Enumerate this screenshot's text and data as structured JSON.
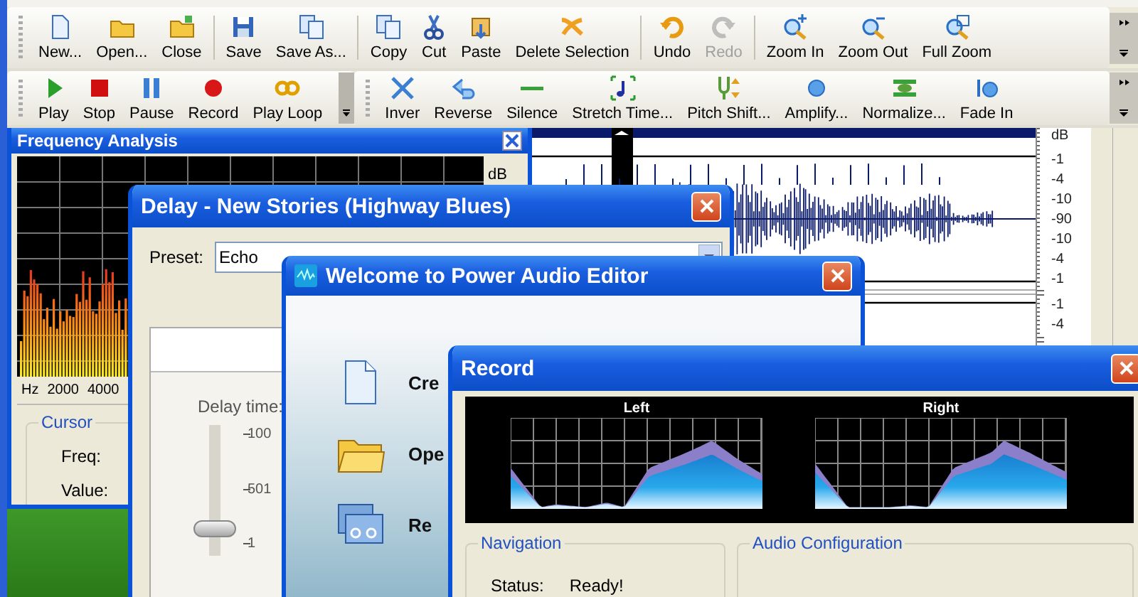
{
  "toolbar_rows": [
    {
      "toolbars": [
        {
          "groups": [
            [
              {
                "label": "New...",
                "disabled": false
              },
              {
                "label": "Open...",
                "disabled": false
              },
              {
                "label": "Close",
                "disabled": false
              }
            ],
            [
              {
                "label": "Save",
                "disabled": false
              },
              {
                "label": "Save As...",
                "disabled": false
              }
            ],
            [
              {
                "label": "Copy",
                "disabled": false
              },
              {
                "label": "Cut",
                "disabled": false
              },
              {
                "label": "Paste",
                "disabled": false
              },
              {
                "label": "Delete Selection",
                "disabled": false
              }
            ],
            [
              {
                "label": "Undo",
                "disabled": false
              },
              {
                "label": "Redo",
                "disabled": true
              }
            ],
            [
              {
                "label": "Zoom In",
                "disabled": false
              },
              {
                "label": "Zoom Out",
                "disabled": false
              },
              {
                "label": "Full Zoom",
                "disabled": false
              }
            ]
          ]
        }
      ]
    },
    {
      "toolbars": [
        {
          "groups": [
            [
              {
                "label": "Play",
                "disabled": false
              },
              {
                "label": "Stop",
                "disabled": false
              },
              {
                "label": "Pause",
                "disabled": false
              },
              {
                "label": "Record",
                "disabled": false
              },
              {
                "label": "Play Loop",
                "disabled": false
              }
            ]
          ]
        },
        {
          "groups": [
            [
              {
                "label": "Inver",
                "disabled": false
              },
              {
                "label": "Reverse",
                "disabled": false
              },
              {
                "label": "Silence",
                "disabled": false
              },
              {
                "label": "Stretch Time...",
                "disabled": false
              },
              {
                "label": "Pitch Shift...",
                "disabled": false
              },
              {
                "label": "Amplify...",
                "disabled": false
              },
              {
                "label": "Normalize...",
                "disabled": false
              },
              {
                "label": "Fade In",
                "disabled": false
              }
            ]
          ]
        }
      ]
    }
  ],
  "waveform": {
    "unit": "dB",
    "channel_1_scale": [
      "-1",
      "-4",
      "-10",
      "-90",
      "-10",
      "-4",
      "-1"
    ],
    "channel_2_scale": [
      "-1",
      "-4"
    ]
  },
  "frequency_analysis": {
    "title": "Frequency Analysis",
    "unit": "dB",
    "axis_labels": [
      "Hz",
      "2000",
      "4000"
    ],
    "cursor": {
      "legend": "Cursor",
      "fields": [
        "Freq:",
        "Value:"
      ]
    }
  },
  "delay_dialog": {
    "title": "Delay - New Stories (Highway Blues)",
    "preset_label": "Preset:",
    "preset_value": "Echo",
    "slider": {
      "label": "Delay time:",
      "level": 0.16,
      "ticks": [
        "100",
        "501",
        "1"
      ]
    }
  },
  "welcome_dialog": {
    "title": "Welcome to Power Audio Editor",
    "items": [
      {
        "label": "Cre"
      },
      {
        "label": "Ope"
      },
      {
        "label": "Re"
      }
    ]
  },
  "record_dialog": {
    "title": "Record",
    "channels": [
      "Left",
      "Right"
    ],
    "navigation": {
      "legend": "Navigation",
      "status_label": "Status:",
      "status_value": "Ready!"
    },
    "audio_configuration": {
      "legend": "Audio Configuration"
    }
  }
}
